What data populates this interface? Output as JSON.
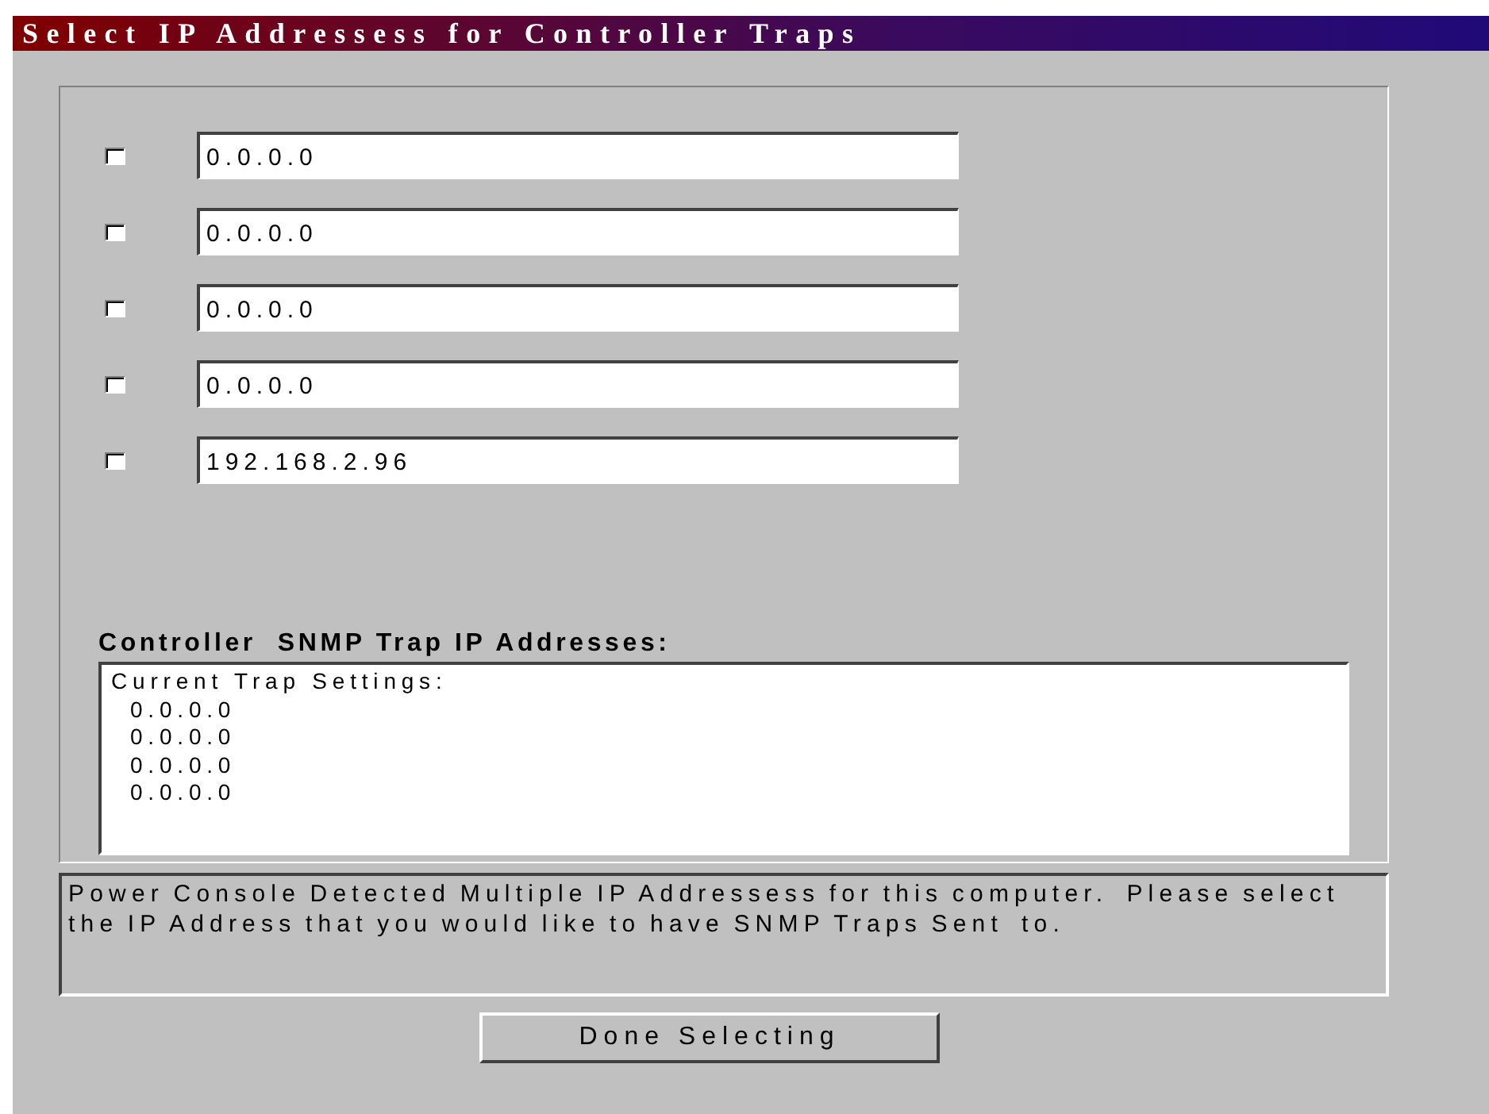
{
  "window": {
    "title": "Select IP Addressess for Controller Traps"
  },
  "addresses": [
    {
      "checked": false,
      "value": "0.0.0.0"
    },
    {
      "checked": false,
      "value": "0.0.0.0"
    },
    {
      "checked": false,
      "value": "0.0.0.0"
    },
    {
      "checked": false,
      "value": "0.0.0.0"
    },
    {
      "checked": false,
      "value": "192.168.2.96"
    }
  ],
  "current_traps": {
    "heading": "Controller  SNMP Trap IP Addresses:",
    "title": "Current Trap Settings:",
    "lines": [
      "0.0.0.0",
      "0.0.0.0",
      "0.0.0.0",
      "0.0.0.0"
    ]
  },
  "message": "Power Console Detected Multiple IP Addressess for this computer.  Please select the IP Address that you would like to have SNMP Traps Sent  to.",
  "buttons": [
    "Done Selecting"
  ]
}
